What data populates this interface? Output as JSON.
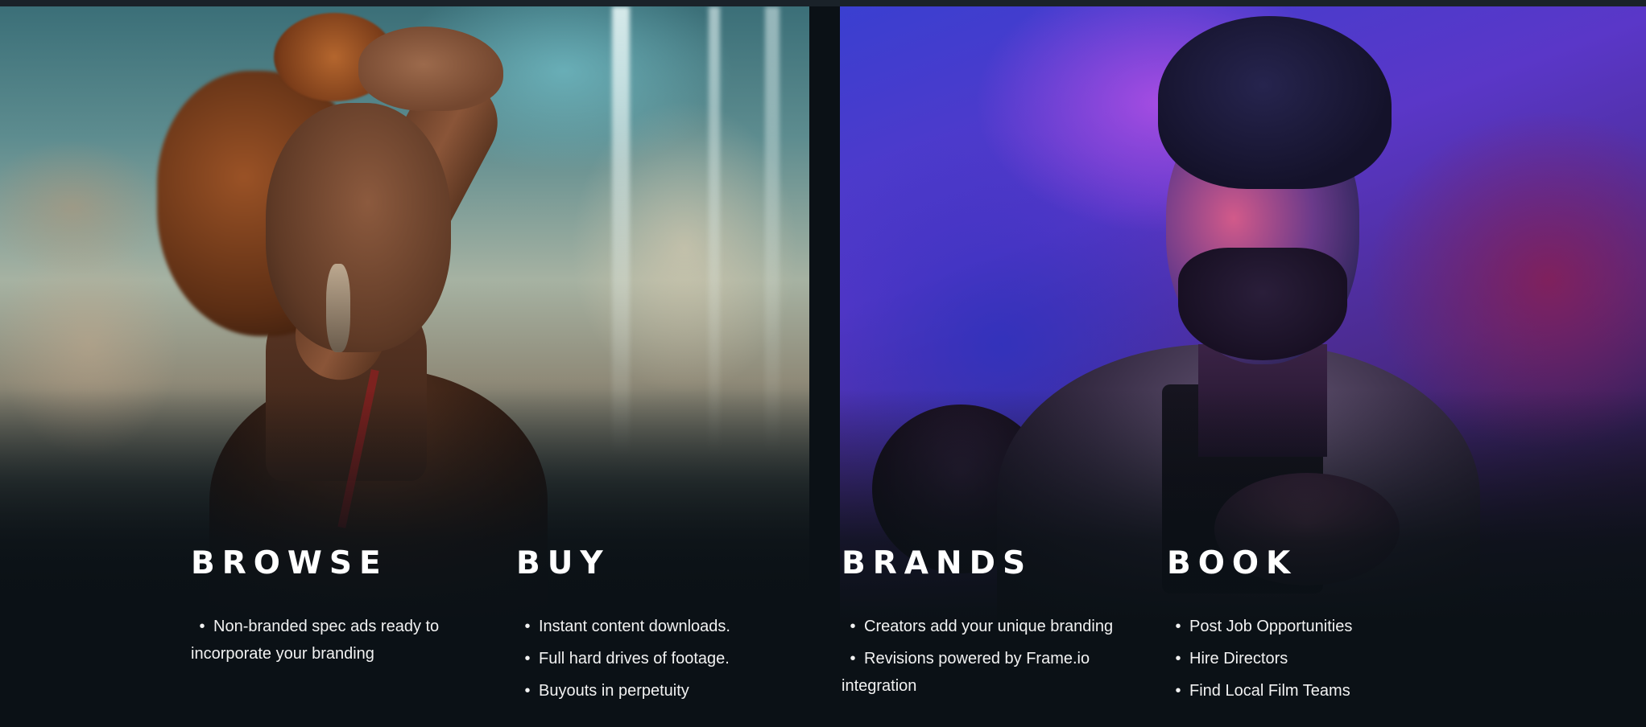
{
  "columns": [
    {
      "heading": "BROWSE",
      "items": [
        "Non-branded spec ads ready to incorporate your branding"
      ]
    },
    {
      "heading": "BUY",
      "items": [
        "Instant content downloads.",
        "Full hard drives of footage.",
        "Buyouts in perpetuity"
      ]
    },
    {
      "heading": "BRANDS",
      "items": [
        "Creators add your unique branding",
        "Revisions powered by Frame.io integration"
      ]
    },
    {
      "heading": "BOOK",
      "items": [
        "Post Job Opportunities",
        "Hire Directors",
        "Find Local Film Teams"
      ]
    }
  ],
  "bullet_char": "•",
  "colors": {
    "background": "#0b1116",
    "text": "#ffffff"
  }
}
